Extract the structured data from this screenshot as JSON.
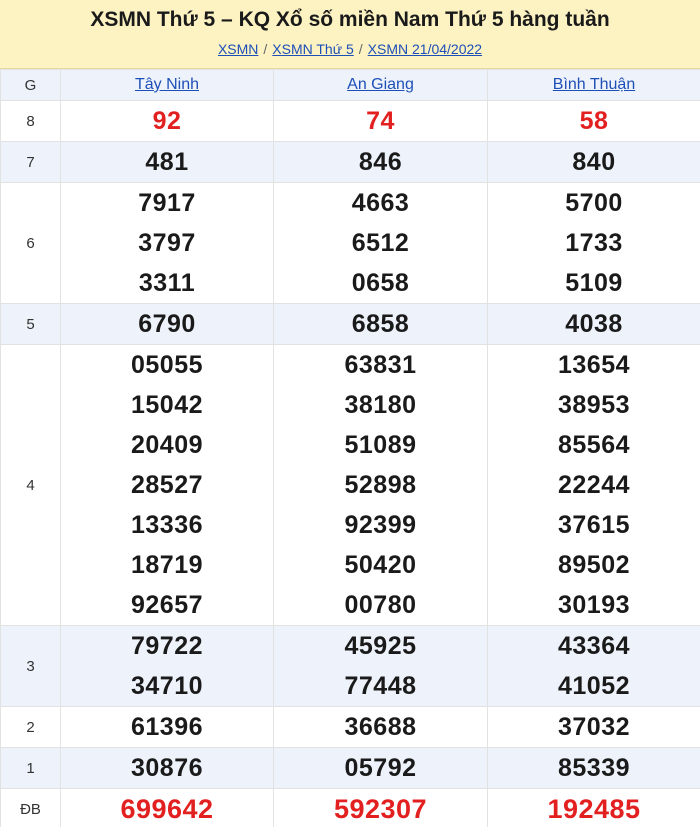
{
  "header": {
    "title": "XSMN Thứ 5 – KQ Xổ số miền Nam Thứ 5 hàng tuần",
    "breadcrumbs": [
      "XSMN",
      "XSMN Thứ 5",
      "XSMN 21/04/2022"
    ],
    "separator": "/"
  },
  "table": {
    "col_label": "G",
    "provinces": [
      "Tây Ninh",
      "An Giang",
      "Bình Thuận"
    ],
    "prizes": [
      {
        "label": "8",
        "values": [
          [
            "92"
          ],
          [
            "74"
          ],
          [
            "58"
          ]
        ]
      },
      {
        "label": "7",
        "values": [
          [
            "481"
          ],
          [
            "846"
          ],
          [
            "840"
          ]
        ]
      },
      {
        "label": "6",
        "values": [
          [
            "7917",
            "3797",
            "3311"
          ],
          [
            "4663",
            "6512",
            "0658"
          ],
          [
            "5700",
            "1733",
            "5109"
          ]
        ]
      },
      {
        "label": "5",
        "values": [
          [
            "6790"
          ],
          [
            "6858"
          ],
          [
            "4038"
          ]
        ]
      },
      {
        "label": "4",
        "values": [
          [
            "05055",
            "15042",
            "20409",
            "28527",
            "13336",
            "18719",
            "92657"
          ],
          [
            "63831",
            "38180",
            "51089",
            "52898",
            "92399",
            "50420",
            "00780"
          ],
          [
            "13654",
            "38953",
            "85564",
            "22244",
            "37615",
            "89502",
            "30193"
          ]
        ]
      },
      {
        "label": "3",
        "values": [
          [
            "79722",
            "34710"
          ],
          [
            "45925",
            "77448"
          ],
          [
            "43364",
            "41052"
          ]
        ]
      },
      {
        "label": "2",
        "values": [
          [
            "61396"
          ],
          [
            "36688"
          ],
          [
            "37032"
          ]
        ]
      },
      {
        "label": "1",
        "values": [
          [
            "30876"
          ],
          [
            "05792"
          ],
          [
            "85339"
          ]
        ]
      },
      {
        "label": "ĐB",
        "values": [
          [
            "699642"
          ],
          [
            "592307"
          ],
          [
            "192485"
          ]
        ]
      }
    ]
  },
  "colors": {
    "header_bg": "#fcf2c2",
    "row_shade": "#eef3fb",
    "link": "#1d4fb8",
    "highlight_red": "#e32020"
  }
}
